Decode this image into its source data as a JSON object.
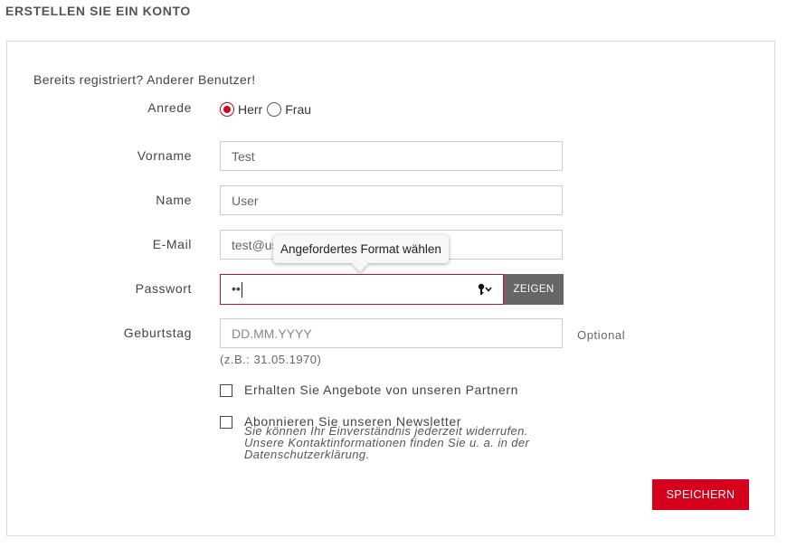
{
  "page": {
    "title": "ERSTELLEN SIE EIN KONTO",
    "login_hint": "Bereits registriert? Anderer Benutzer!"
  },
  "form": {
    "salutation": {
      "label": "Anrede",
      "options": [
        {
          "label": "Herr",
          "selected": true
        },
        {
          "label": "Frau",
          "selected": false
        }
      ]
    },
    "first_name": {
      "label": "Vorname",
      "value": "Test"
    },
    "last_name": {
      "label": "Name",
      "value": "User"
    },
    "email": {
      "label": "E-Mail",
      "value": "test@us"
    },
    "password": {
      "label": "Passwort",
      "masked_value": "••",
      "show_button": "ZEIGEN",
      "icon": "key-icon"
    },
    "birthday": {
      "label": "Geburtstag",
      "placeholder": "DD.MM.YYYY",
      "optional": "Optional",
      "example": "(z.B.: 31.05.1970)"
    },
    "partner_offers": {
      "label": "Erhalten Sie Angebote von unseren Partnern",
      "checked": false
    },
    "newsletter": {
      "label": "Abonnieren Sie unseren Newsletter",
      "note": "Sie können Ihr Einverständnis jederzeit widerrufen. Unsere Kontaktinformationen finden Sie u. a. in der Datenschutzerklärung.",
      "checked": false
    },
    "save_button": "SPEICHERN"
  },
  "tooltip": {
    "text": "Angefordertes Format wählen"
  },
  "colors": {
    "accent": "#d4001c",
    "button_gray": "#666666",
    "error_border": "#c0132b"
  }
}
